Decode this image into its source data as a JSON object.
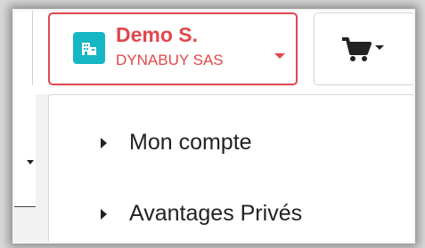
{
  "account": {
    "name": "Demo S.",
    "company": "DYNABUY SAS"
  },
  "cart": {
    "icon": "shopping-cart-icon"
  },
  "menu": {
    "items": [
      {
        "label": "Mon compte"
      },
      {
        "label": "Avantages Privés"
      }
    ]
  },
  "colors": {
    "accent": "#e0474c",
    "avatar_bg": "#17b6c5"
  }
}
